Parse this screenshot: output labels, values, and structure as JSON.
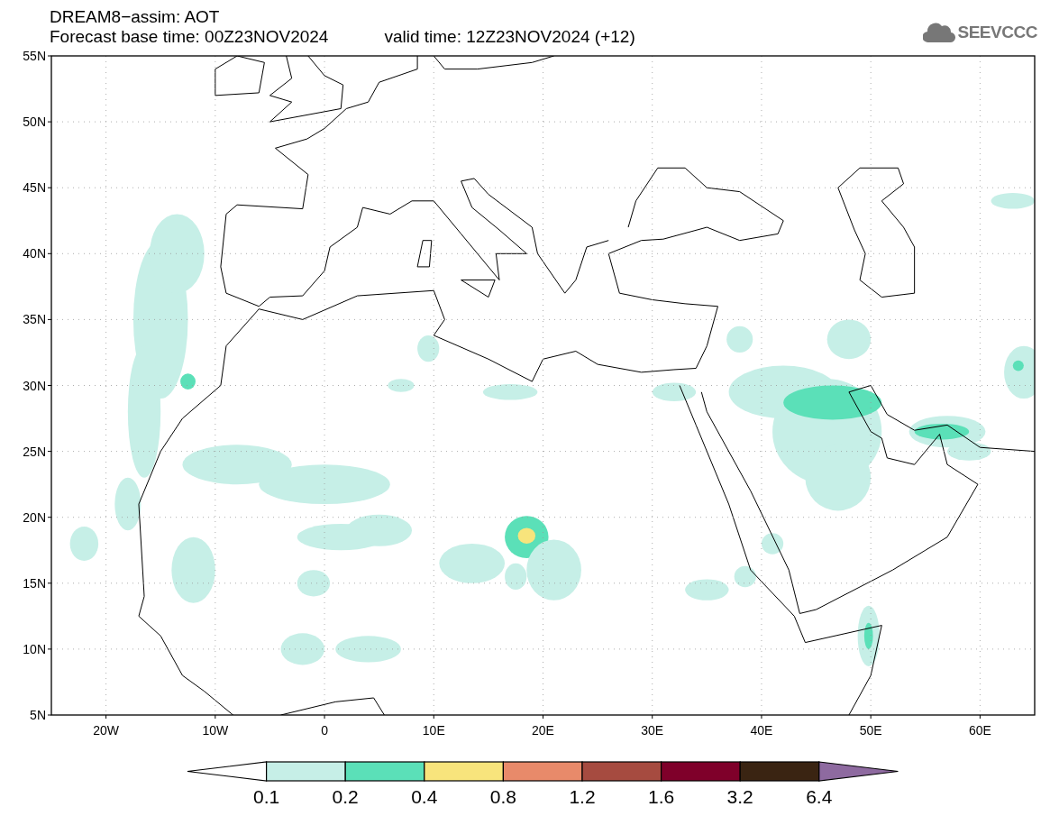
{
  "header": {
    "title": "DREAM8−assim: AOT",
    "base_time": "Forecast base time: 00Z23NOV2024",
    "valid_time": "valid time: 12Z23NOV2024 (+12)",
    "logo": "SEEVCCC"
  },
  "map": {
    "y_labels": [
      "55N",
      "50N",
      "45N",
      "40N",
      "35N",
      "30N",
      "25N",
      "20N",
      "15N",
      "10N",
      "5N"
    ],
    "x_labels": [
      "20W",
      "10W",
      "0",
      "10E",
      "20E",
      "30E",
      "40E",
      "50E",
      "60E"
    ]
  },
  "colorbar": {
    "segments": [
      {
        "kind": "arrow-left",
        "color": "#ffffff"
      },
      {
        "kind": "box",
        "color": "#c6efe7"
      },
      {
        "kind": "box",
        "color": "#5be0b8"
      },
      {
        "kind": "box",
        "color": "#f8e47c"
      },
      {
        "kind": "box",
        "color": "#e88a6a"
      },
      {
        "kind": "box",
        "color": "#a64b40"
      },
      {
        "kind": "box",
        "color": "#7f002a"
      },
      {
        "kind": "box",
        "color": "#3a2412"
      },
      {
        "kind": "arrow-right",
        "color": "#8e6aa0"
      }
    ],
    "labels": [
      "0.1",
      "0.2",
      "0.4",
      "0.8",
      "1.2",
      "1.6",
      "3.2",
      "6.4"
    ]
  }
}
